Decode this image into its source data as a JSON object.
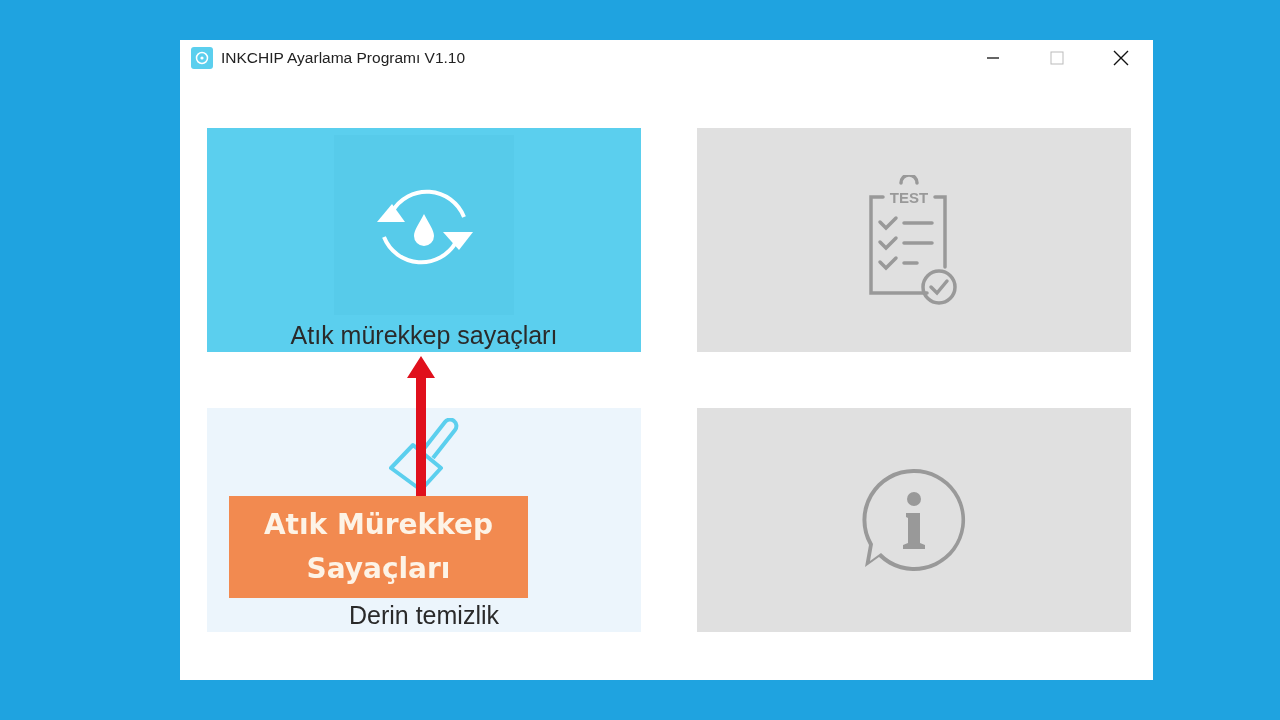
{
  "window": {
    "title": "INKCHIP Ayarlama Programı V1.10"
  },
  "tiles": [
    {
      "kind": "refresh",
      "label": "Atık mürekkep sayaçları",
      "selected": true,
      "disabled": false
    },
    {
      "kind": "brush",
      "label": "Derin temizlik",
      "selected": false,
      "disabled": false
    },
    {
      "kind": "test",
      "icon_text": "TEST",
      "selected": false,
      "disabled": true
    },
    {
      "kind": "info",
      "selected": false,
      "disabled": true
    }
  ],
  "annotation": {
    "text": "Atık Mürekkep Sayaçları"
  }
}
